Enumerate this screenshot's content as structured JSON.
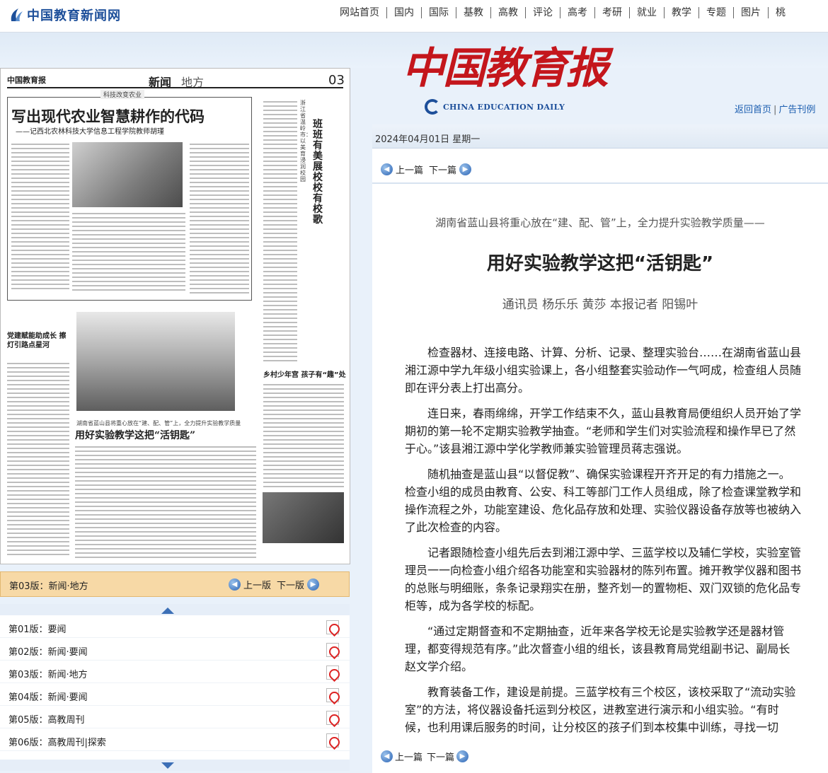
{
  "site": {
    "name": "中国教育新闻网",
    "nav": [
      "网站首页",
      "国内",
      "国际",
      "基教",
      "高教",
      "评论",
      "高考",
      "考研",
      "就业",
      "教学",
      "专题",
      "图片",
      "桃"
    ]
  },
  "newspaper": {
    "name_cn": "中国教育报",
    "name_en": "CHINA EDUCATION DAILY",
    "links": {
      "home": "返回首页",
      "ads": "广告刊例"
    },
    "date": "2024年04月01日 星期一"
  },
  "page_image": {
    "masthead": "中国教育报",
    "section": "新闻",
    "section2": "地方",
    "page_number": "03",
    "kicker": "科技改变农业",
    "headline": "写出现代农业智慧耕作的代码",
    "subhead": "——记西北农林科技大学信息工程学院教师胡瑾",
    "vertical_title": "班班有美展 校校有校歌",
    "vertical_sub": "浙江省温岭市：以美育浸润校园",
    "left_headline": "党建赋能助成长 擦灯引路点星河",
    "mid_kicker": "湖南省蓝山县将重心放在“建、配、管”上，全力提升实验教学质量",
    "mid_headline": "用好实验教学这把“活钥匙”",
    "right_headline": "乡村少年宫 孩子有“趣”处"
  },
  "page_bar": {
    "current": "第03版：新闻·地方",
    "prev": "上一版",
    "next": "下一版"
  },
  "page_list": [
    {
      "label": "第01版：要闻"
    },
    {
      "label": "第02版：新闻·要闻"
    },
    {
      "label": "第03版：新闻·地方"
    },
    {
      "label": "第04版：新闻·要闻"
    },
    {
      "label": "第05版：高教周刊"
    },
    {
      "label": "第06版：高教周刊|探索"
    }
  ],
  "article": {
    "prev": "上一篇",
    "next": "下一篇",
    "lead": "湖南省蓝山县将重心放在“建、配、管”上，全力提升实验教学质量——",
    "title": "用好实验教学这把“活钥匙”",
    "author": "通讯员 杨乐乐 黄莎 本报记者 阳锡叶",
    "paragraphs": [
      "检查器材、连接电路、计算、分析、记录、整理实验台……在湖南省蓝山县湘江源中学九年级小组实验课上，各小组整套实验动作一气呵成，检查组人员随即在评分表上打出高分。",
      "连日来，春雨绵绵，开学工作结束不久，蓝山县教育局便组织人员开始了学期初的第一轮不定期实验教学抽查。“老师和学生们对实验流程和操作早已了然于心。”该县湘江源中学化学教师兼实验管理员蒋志强说。",
      "随机抽查是蓝山县“以督促教”、确保实验课程开齐开足的有力措施之一。检查小组的成员由教育、公安、科工等部门工作人员组成，除了检查课堂教学和操作流程之外，功能室建设、危化品存放和处理、实验仪器设备存放等也被纳入了此次检查的内容。",
      "记者跟随检查小组先后去到湘江源中学、三蓝学校以及辅仁学校，实验室管理员一一向检查小组介绍各功能室和实验器材的陈列布置。摊开教学仪器和图书的总账与明细账，条条记录翔实在册，整齐划一的置物柜、双门双锁的危化品专柜等，成为各学校的标配。",
      "“通过定期督查和不定期抽查，近年来各学校无论是实验教学还是器材管理，都变得规范有序。”此次督查小组的组长，该县教育局党组副书记、副局长赵文学介绍。",
      "教育装备工作，建设是前提。三蓝学校有三个校区，该校采取了“流动实验室”的方法，将仪器设备托运到分校区，进教室进行演示和小组实验。“有时候，也利用课后服务的时间，让分校区的孩子们到本校集中训练，寻找一切"
    ]
  }
}
